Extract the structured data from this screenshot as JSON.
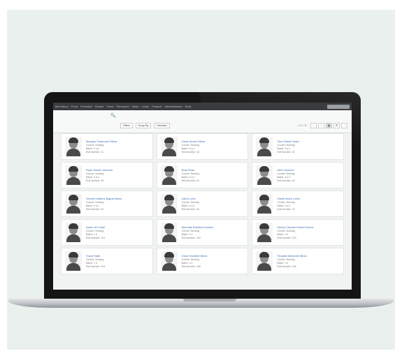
{
  "menubar": {
    "items": [
      "Mes Menu",
      "Front",
      "Frontales",
      "Search",
      "Trace",
      "Personnel",
      "Ideas",
      "Leave",
      "Finance",
      "Administration",
      "Bulls"
    ]
  },
  "toolbar": {
    "filters": [
      "Filters",
      "Group By",
      "Favorites"
    ],
    "pager_text": "1-15 / 20"
  },
  "students": [
    {
      "name": "Maryam Tarannum Mirza",
      "course": "Course: Nursing",
      "batch": "Batch: 3 a.2",
      "roll": "Roll Number: 11"
    },
    {
      "name": "Omar Ameer Mirza",
      "course": "Course: Nursing",
      "batch": "Batch: 3 a.2",
      "roll": "Roll Number: 16"
    },
    {
      "name": "Tara Sheikh Nazir",
      "course": "Course: Nursing",
      "batch": "Batch: 3 a.2",
      "roll": "Roll Number: 31"
    },
    {
      "name": "Ryan Daniel Johnson",
      "course": "Course: Nursing",
      "batch": "Batch: 3 a.2",
      "roll": "Roll Number: 40"
    },
    {
      "name": "Boat Shan",
      "course": "Course: Nursing",
      "batch": "Batch: 3 a.2",
      "roll": "Roll Number: 41"
    },
    {
      "name": "Ariel Johnson",
      "course": "Course: Nursing",
      "batch": "Batch: 3 a.2",
      "roll": "Roll Number: 42"
    },
    {
      "name": "Vincent Martins Bajpai Nlend",
      "course": "Course: Nursing",
      "batch": "Batch: 3 a.2",
      "roll": "Roll Number: 51"
    },
    {
      "name": "Zahid Lone",
      "course": "Course: Nursing",
      "batch": "Batch: 3 a.2",
      "roll": "Roll Number: 60"
    },
    {
      "name": "Habib Imam Lodhi",
      "course": "Course: Nursing",
      "batch": "Batch: 3 a.2",
      "roll": "Roll Number: 74"
    },
    {
      "name": "Adam Al-Fuisal",
      "course": "Course: Nursing",
      "batch": "Batch: 1 b",
      "roll": "Roll Number: 101"
    },
    {
      "name": "Nicholas Bradford Jordan",
      "course": "Course: Nursing",
      "batch": "Batch: 1 b",
      "roll": "Roll Number: 102"
    },
    {
      "name": "Danny Candan Ahmed Kiona",
      "course": "Course: Nursing",
      "batch": "Batch: 1 b",
      "roll": "Roll Number: 103"
    },
    {
      "name": "Yusuf Saab",
      "course": "Course: Nursing",
      "batch": "Batch: 1 b",
      "roll": "Roll Number: 104"
    },
    {
      "name": "Omar Suhaimi Mirza",
      "course": "Course: Nursing",
      "batch": "Batch: 1 b",
      "roll": "Roll Number: 105"
    },
    {
      "name": "Tinuade Adewumi Mirza",
      "course": "Course: Nursing",
      "batch": "Batch: 1 b",
      "roll": "Roll Number: 106"
    }
  ],
  "colors": {
    "link": "#3b6fb6",
    "menubar": "#3a3d40",
    "backdrop": "#e9f0ee"
  }
}
